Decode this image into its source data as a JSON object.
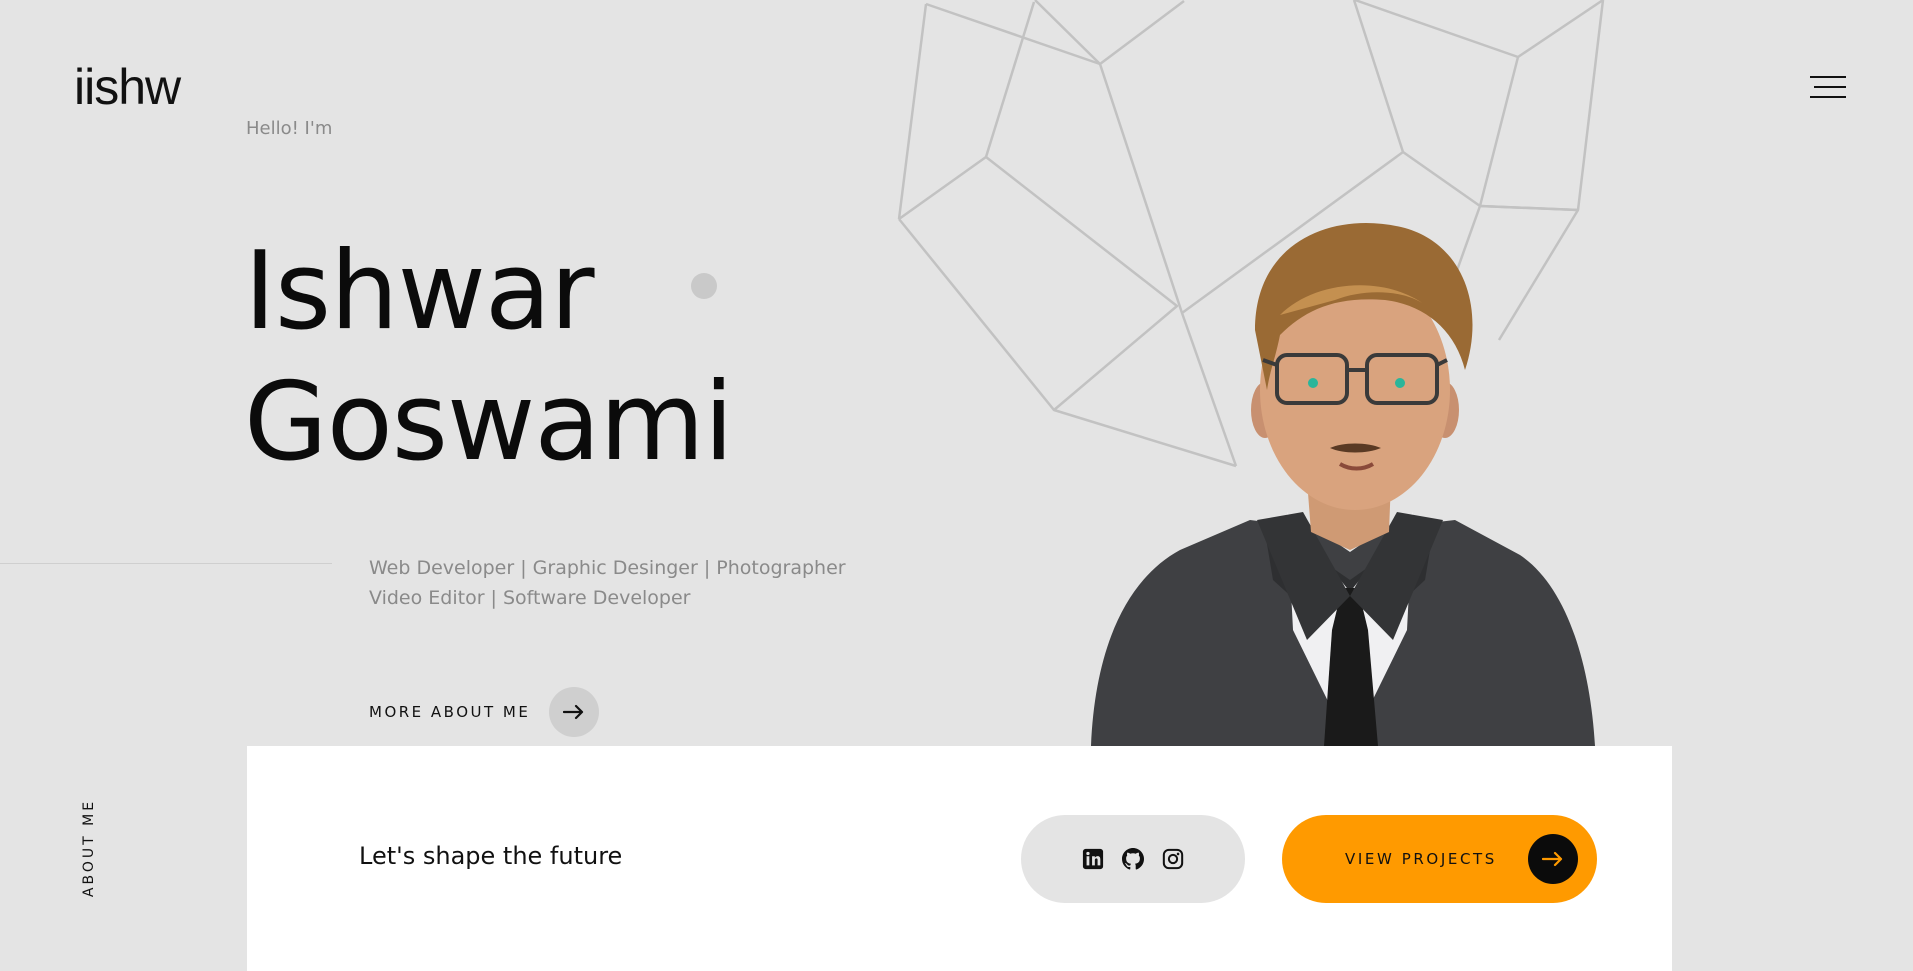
{
  "header": {
    "logo": "iishw",
    "menu_icon": "hamburger-menu-icon"
  },
  "hero": {
    "greeting": "Hello! I'm",
    "first_name": "Ishwar",
    "last_name": "Goswami",
    "roles_line1": "Web Developer | Graphic Desinger | Photographer",
    "roles_line2": "Video Editor | Software Developer",
    "more_button_label": "MORE ABOUT ME",
    "more_button_icon": "arrow-right-icon"
  },
  "side": {
    "vertical_label": "ABOUT ME"
  },
  "bottom_card": {
    "tagline": "Let's shape the future",
    "social_icons": [
      "linkedin-icon",
      "github-icon",
      "instagram-icon"
    ],
    "view_projects_label": "VIEW PROJECTS",
    "view_projects_icon": "arrow-right-icon"
  },
  "colors": {
    "background": "#e4e4e4",
    "accent": "#ff9a00",
    "text": "#111111",
    "muted": "#8a8a8a"
  }
}
